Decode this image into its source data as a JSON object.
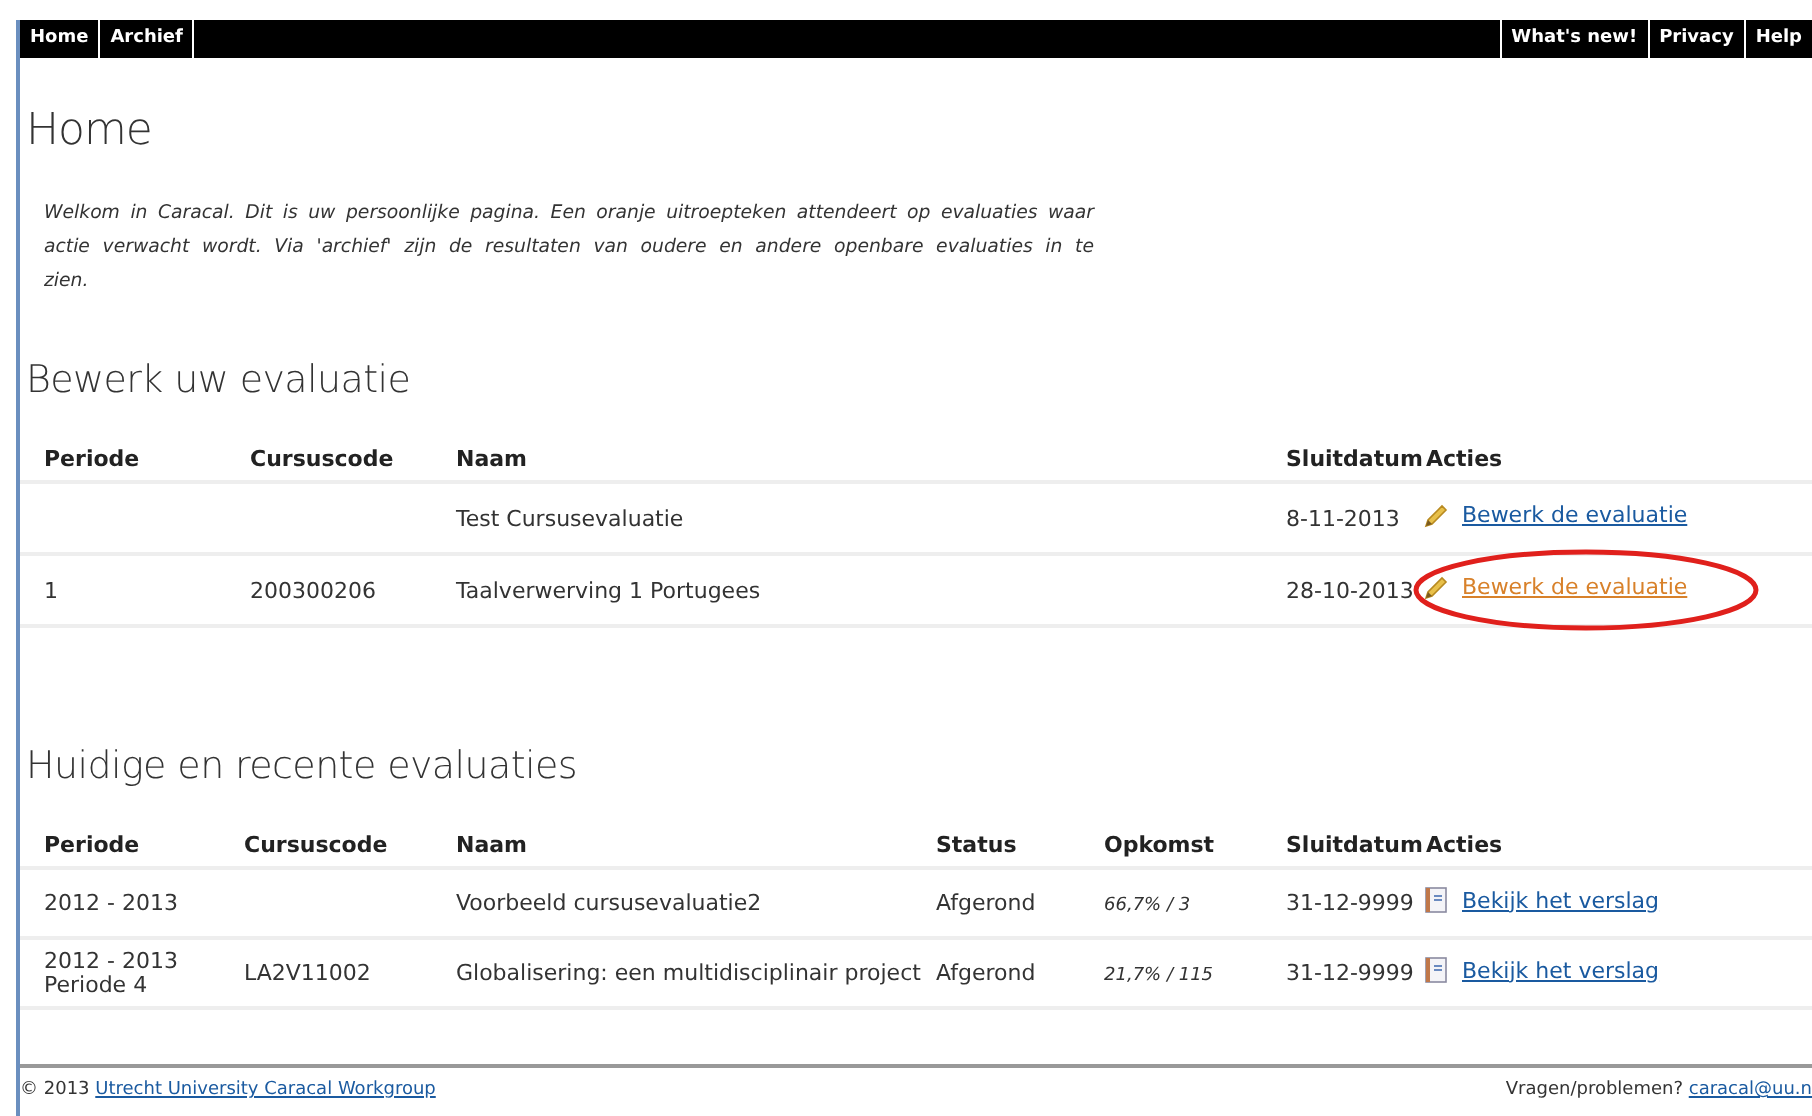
{
  "nav": {
    "left": [
      "Home",
      "Archief"
    ],
    "right": [
      "What's new!",
      "Privacy",
      "Help"
    ]
  },
  "page_title": "Home",
  "intro": "Welkom in Caracal. Dit is uw persoonlijke pagina. Een oranje uitroepteken attendeert op evaluaties waar actie verwacht wordt. Via 'archief' zijn de resultaten van oudere en andere openbare evaluaties in te zien.",
  "edit_section": {
    "title": "Bewerk uw evaluatie",
    "columns": [
      "Periode",
      "Cursuscode",
      "Naam",
      "Sluitdatum",
      "Acties"
    ],
    "rows": [
      {
        "periode": "",
        "code": "",
        "naam": "Test Cursusevaluatie",
        "sluitdatum": "8-11-2013",
        "action": "Bewerk de evaluatie",
        "urgent": false,
        "circled": false
      },
      {
        "periode": "1",
        "code": "200300206",
        "naam": "Taalverwerving 1 Portugees",
        "sluitdatum": "28-10-2013",
        "action": "Bewerk de evaluatie",
        "urgent": true,
        "circled": true
      }
    ]
  },
  "recent_section": {
    "title": "Huidige en recente evaluaties",
    "columns": [
      "Periode",
      "Cursuscode",
      "Naam",
      "Status",
      "Opkomst",
      "Sluitdatum",
      "Acties"
    ],
    "rows": [
      {
        "periode": [
          "2012 - 2013"
        ],
        "code": "",
        "naam": "Voorbeeld cursusevaluatie2",
        "status": "Afgerond",
        "opkomst": "66,7% / 3",
        "sluitdatum": "31-12-9999",
        "action": "Bekijk het verslag"
      },
      {
        "periode": [
          "2012 - 2013",
          "Periode 4"
        ],
        "code": "LA2V11002",
        "naam": "Globalisering: een multidisciplinair project",
        "status": "Afgerond",
        "opkomst": "21,7% / 115",
        "sluitdatum": "31-12-9999",
        "action": "Bekijk het verslag"
      }
    ]
  },
  "footer": {
    "copyright": "© 2013",
    "link": "Utrecht University Caracal Workgroup",
    "contact_label": "Vragen/problemen?",
    "email": "caracal@uu.n"
  }
}
